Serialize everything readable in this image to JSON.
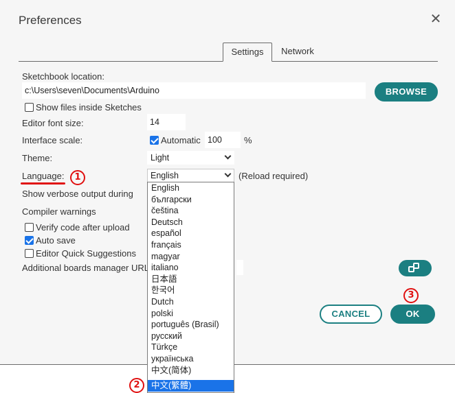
{
  "dialog": {
    "title": "Preferences",
    "close_glyph": "✕"
  },
  "tabs": [
    {
      "label": "Settings",
      "active": true
    },
    {
      "label": "Network",
      "active": false
    }
  ],
  "settings": {
    "sketchbook_label": "Sketchbook location:",
    "sketchbook_path": "c:\\Users\\seven\\Documents\\Arduino",
    "browse_label": "BROWSE",
    "show_files_label": "Show files inside Sketches",
    "show_files_checked": false,
    "font_size_label": "Editor font size:",
    "font_size_value": "14",
    "scale_label": "Interface scale:",
    "scale_auto_label": "Automatic",
    "scale_auto_checked": true,
    "scale_value": "100",
    "scale_unit": "%",
    "theme_label": "Theme:",
    "theme_value": "Light",
    "language_label": "Language:",
    "language_value": "English",
    "reload_note": "(Reload required)",
    "verbose_label": "Show verbose output during",
    "compiler_warnings_label": "Compiler warnings",
    "verify_label": "Verify code after upload",
    "verify_checked": false,
    "autosave_label": "Auto save",
    "autosave_checked": true,
    "quick_suggestions_label": "Editor Quick Suggestions",
    "quick_suggestions_checked": false,
    "boards_url_label": "Additional boards manager URL"
  },
  "language_options": [
    "English",
    "български",
    "čeština",
    "Deutsch",
    "español",
    "français",
    "magyar",
    "italiano",
    "日本語",
    "한국어",
    "Dutch",
    "polski",
    "português (Brasil)",
    "русский",
    "Türkçe",
    "українська",
    "中文(简体)",
    "中文(繁體)"
  ],
  "language_highlighted_index": 17,
  "buttons": {
    "cancel": "CANCEL",
    "ok": "OK"
  },
  "annotations": {
    "marker_1": "1",
    "marker_2": "2",
    "marker_3": "3"
  },
  "colors": {
    "accent": "#1b7f81",
    "highlight": "#1a73e8",
    "annotation_red": "#e01010"
  }
}
